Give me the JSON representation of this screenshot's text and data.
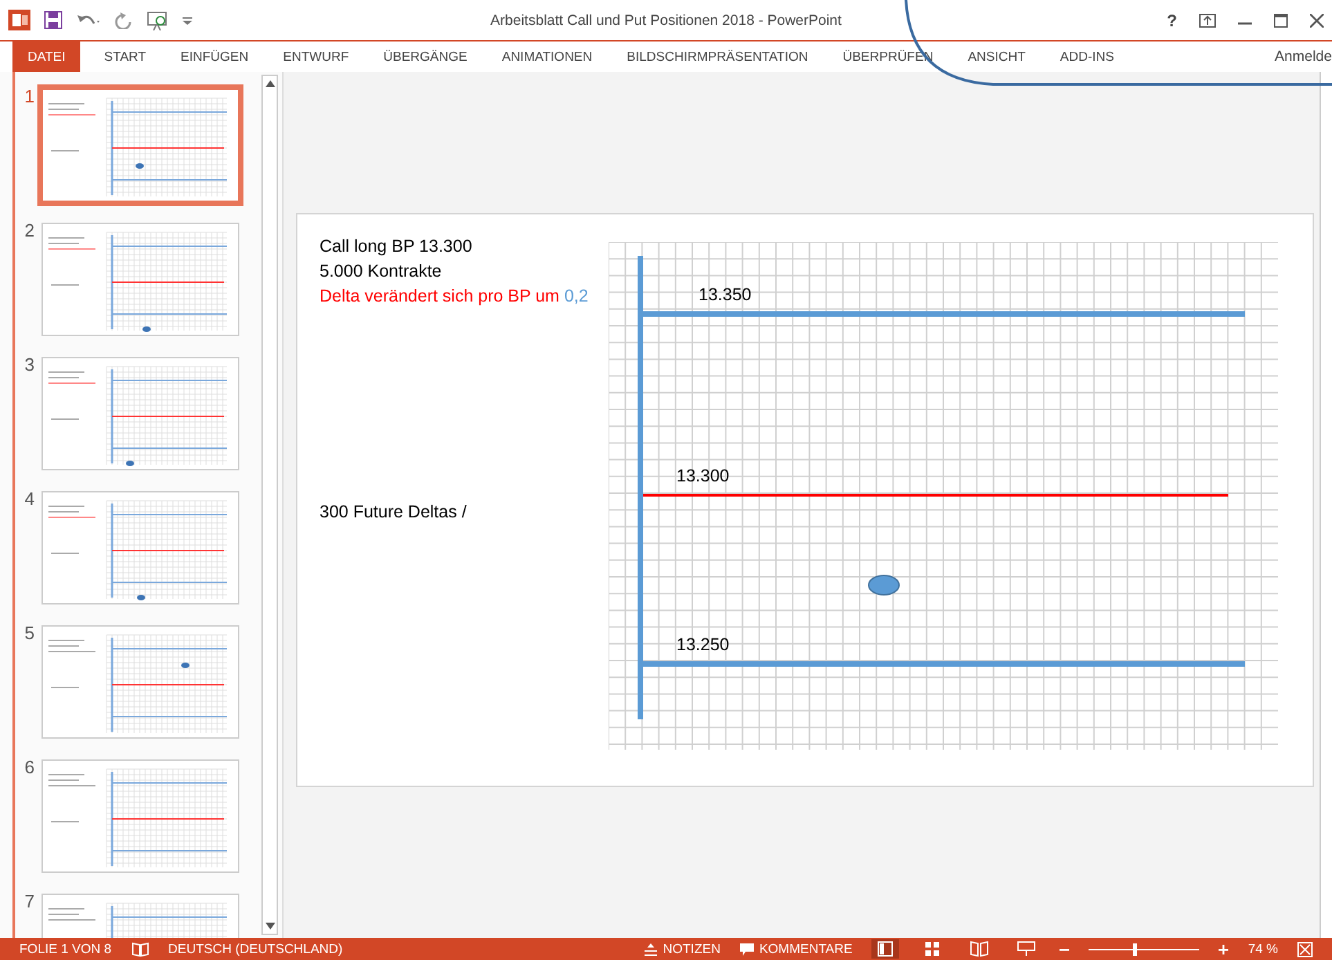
{
  "window": {
    "title": "Arbeitsblatt Call und Put Positionen 2018 - PowerPoint",
    "account": "Anmelde"
  },
  "tabs": [
    {
      "label": "DATEI",
      "selected": true
    },
    {
      "label": "START",
      "selected": false
    },
    {
      "label": "EINFÜGEN",
      "selected": false
    },
    {
      "label": "ENTWURF",
      "selected": false
    },
    {
      "label": "ÜBERGÄNGE",
      "selected": false
    },
    {
      "label": "ANIMATIONEN",
      "selected": false
    },
    {
      "label": "BILDSCHIRMPRÄSENTATION",
      "selected": false
    },
    {
      "label": "ÜBERPRÜFEN",
      "selected": false
    },
    {
      "label": "ANSICHT",
      "selected": false
    },
    {
      "label": "ADD-INS",
      "selected": false
    }
  ],
  "help": "?",
  "thumbnails": [
    {
      "number": "1",
      "selected": true
    },
    {
      "number": "2",
      "selected": false
    },
    {
      "number": "3",
      "selected": false
    },
    {
      "number": "4",
      "selected": false
    },
    {
      "number": "5",
      "selected": false
    },
    {
      "number": "6",
      "selected": false
    },
    {
      "number": "7",
      "selected": false
    }
  ],
  "slide": {
    "text_lines": [
      {
        "segments": [
          {
            "text": "Call long BP 13.300",
            "color": "#000000"
          }
        ]
      },
      {
        "segments": [
          {
            "text": "5.000 Kontrakte",
            "color": "#000000"
          }
        ]
      },
      {
        "segments": [
          {
            "text": "Delta verändert sich pro BP um ",
            "color": "#ff0000"
          },
          {
            "text": "0,2",
            "color": "#5b9bd5"
          }
        ]
      }
    ],
    "note": "300 Future Deltas /",
    "levels": [
      {
        "label": "13.350",
        "color": "#5b9bd5"
      },
      {
        "label": "13.300",
        "color": "#ff0000"
      },
      {
        "label": "13.250",
        "color": "#5b9bd5"
      }
    ]
  },
  "status_bar": {
    "slide_info": "FOLIE 1 VON 8",
    "language": "DEUTSCH (DEUTSCHLAND)",
    "notes": "NOTIZEN",
    "comments": "KOMMENTARE",
    "zoom": {
      "level": 0.4,
      "reading": "74 %"
    }
  }
}
